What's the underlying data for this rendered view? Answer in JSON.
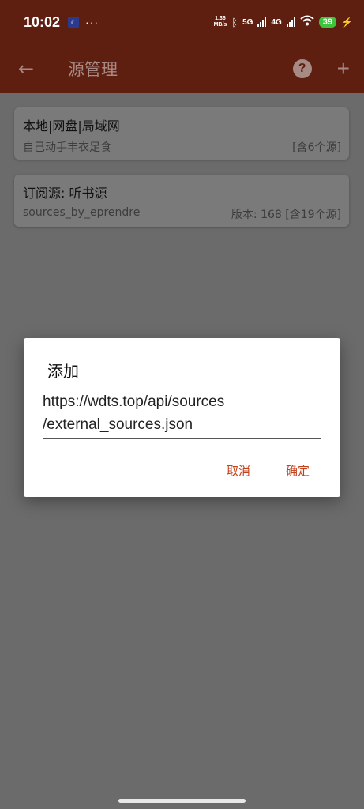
{
  "status_bar": {
    "time": "10:02",
    "dots": "···",
    "net_speed_value": "1.36",
    "net_speed_unit": "MB/s",
    "sim1": "5G",
    "sim2": "4G",
    "battery": "39"
  },
  "app_bar": {
    "title": "源管理",
    "help_label": "?",
    "add_label": "+",
    "back_label": "←"
  },
  "sources": [
    {
      "title": "本地|网盘|局域网",
      "subtitle": "自己动手丰衣足食",
      "meta": "[含6个源]"
    },
    {
      "title": "订阅源: 听书源",
      "subtitle": "sources_by_eprendre",
      "meta": "版本: 168 [含19个源]"
    }
  ],
  "dialog": {
    "title": "添加",
    "input_value": "https://wdts.top/api/sources/external_sources.json",
    "cancel_label": "取消",
    "ok_label": "确定"
  }
}
